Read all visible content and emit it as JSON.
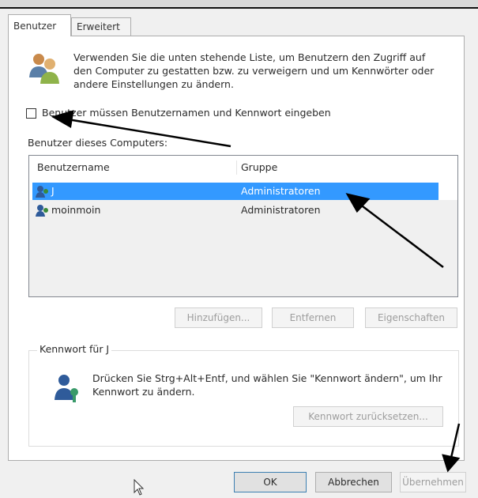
{
  "tabs": [
    {
      "label": "Benutzer",
      "active": true
    },
    {
      "label": "Erweitert",
      "active": false
    }
  ],
  "intro": {
    "icon": "users-icon",
    "text": "Verwenden Sie die unten stehende Liste, um Benutzern den Zugriff auf den Computer zu gestatten bzw. zu verweigern und um Kennwörter oder andere Einstellungen zu ändern."
  },
  "require_login": {
    "label": "Benutzer müssen Benutzernamen und Kennwort eingeben",
    "checked": false
  },
  "users_section": {
    "label": "Benutzer dieses Computers:",
    "columns": [
      "Benutzername",
      "Gruppe"
    ],
    "rows": [
      {
        "name": "J",
        "group": "Administratoren",
        "selected": true,
        "icon": "user-icon"
      },
      {
        "name": "moinmoin",
        "group": "Administratoren",
        "selected": false,
        "icon": "user-icon"
      }
    ]
  },
  "list_buttons": {
    "add": "Hinzufügen...",
    "remove": "Entfernen",
    "properties": "Eigenschaften"
  },
  "password_box": {
    "title": "Kennwort für J",
    "icon": "user-key-icon",
    "text": "Drücken Sie Strg+Alt+Entf, und wählen Sie \"Kennwort ändern\", um Ihr Kennwort zu ändern.",
    "reset_button": "Kennwort zurücksetzen..."
  },
  "dialog_buttons": {
    "ok": "OK",
    "cancel": "Abbrechen",
    "apply": "Übernehmen"
  },
  "colors": {
    "selection": "#3399ff",
    "annotation_arrow": "#000000"
  }
}
